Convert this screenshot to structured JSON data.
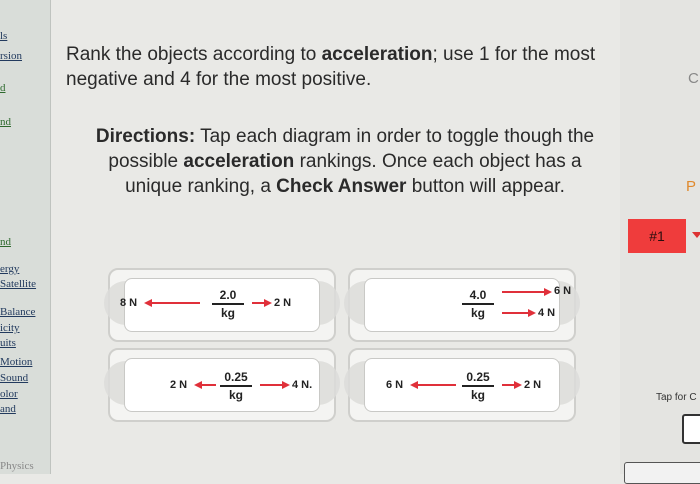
{
  "sidebar": {
    "items": [
      {
        "label": "ls"
      },
      {
        "label": "rsion"
      },
      {
        "label": "d"
      },
      {
        "label": "nd"
      },
      {
        "label": "nd"
      },
      {
        "label": "ergy"
      },
      {
        "label": "Satellite"
      },
      {
        "label": "Balance"
      },
      {
        "label": "icity"
      },
      {
        "label": "uits"
      },
      {
        "label": "Motion"
      },
      {
        "label": "Sound"
      },
      {
        "label": "olor"
      },
      {
        "label": "and"
      },
      {
        "label": "Physics"
      }
    ]
  },
  "main": {
    "prompt": {
      "p1": "Rank the objects according to ",
      "bold": "acceleration",
      "p2": "; use 1 for the most negative and 4 for the most positive."
    },
    "directions": {
      "label": "Directions:",
      "t1": " Tap each diagram in order to toggle though the possible ",
      "bold1": "acceleration",
      "t2": " rankings. Once each object has a unique ranking, a ",
      "bold2": "Check Answer",
      "t3": " button will appear."
    },
    "cards": [
      {
        "mass_top": "2.0",
        "mass_bot": "kg",
        "left_force": "8 N",
        "right_force": "2 N"
      },
      {
        "mass_top": "4.0",
        "mass_bot": "kg",
        "right_force_top": "6 N",
        "right_force_bot": "4 N"
      },
      {
        "mass_top": "0.25",
        "mass_bot": "kg",
        "left_force": "2 N",
        "right_force": "4 N."
      },
      {
        "mass_top": "0.25",
        "mass_bot": "kg",
        "left_force": "6 N",
        "right_force": "2 N"
      }
    ]
  },
  "right_panel": {
    "letter_c": "C",
    "letter_p": "P",
    "rank_tag": "#1",
    "tap_text": "Tap for C"
  },
  "colors": {
    "rank_tag": "#ef3c3c",
    "arrow": "#e0303a",
    "letter_p": "#e08a2e"
  }
}
